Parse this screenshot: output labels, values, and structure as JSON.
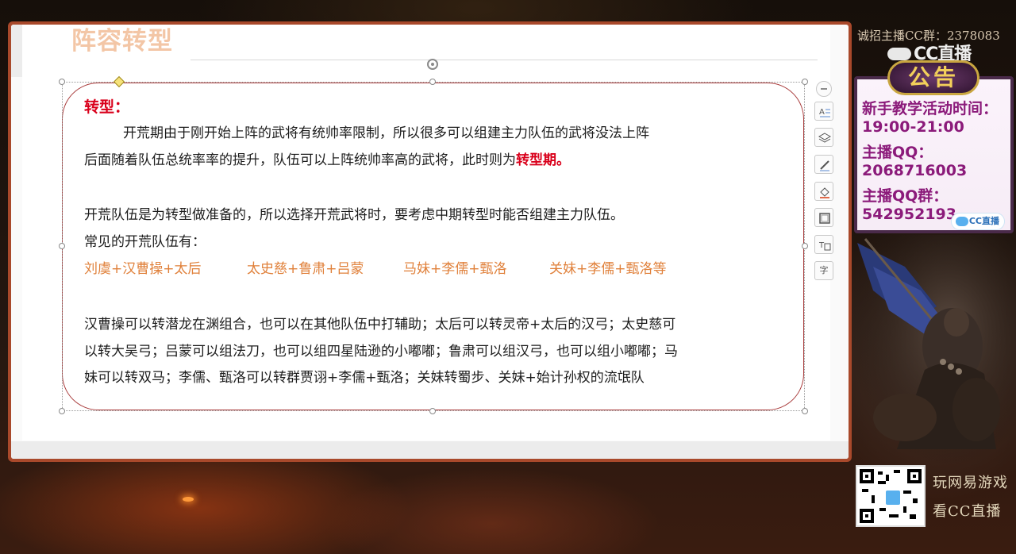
{
  "slide": {
    "title": "阵容转型",
    "heading": "转型：",
    "paragraph1_line1": "开荒期由于刚开始上阵的武将有统帅率限制，所以很多可以组建主力队伍的武将没法上阵",
    "paragraph1_line2_prefix": "后面随着队伍总统率率的提升，队伍可以上阵统帅率高的武将，此时则为",
    "paragraph1_line2_highlight": "转型期。",
    "paragraph2": "开荒队伍是为转型做准备的，所以选择开荒武将时，要考虑中期转型时能否组建主力队伍。",
    "paragraph3": "常见的开荒队伍有：",
    "teams": [
      "刘虞+汉曹操+太后",
      "太史慈+鲁肃+吕蒙",
      "马妹+李儒+甄洛",
      "关妹+李儒+甄洛等"
    ],
    "paragraph4": [
      "汉曹操可以转潜龙在渊组合，也可以在其他队伍中打辅助；太后可以转灵帝+太后的汉弓；太史慈可",
      "以转大吴弓；吕蒙可以组法刀，也可以组四星陆逊的小嘟嘟；鲁肃可以组汉弓，也可以组小嘟嘟；马",
      "妹可以转双马；李儒、甄洛可以转群贾诩+李儒+甄洛；关妹转蜀步、关妹+始计孙权的流氓队"
    ]
  },
  "side_toolbar": {
    "icons": [
      "collapse-icon",
      "text-format-icon",
      "layers-icon",
      "pen-icon",
      "fill-icon",
      "border-icon",
      "text-box-icon",
      "character-icon"
    ],
    "char_label": "字"
  },
  "stream_panel": {
    "recruit_banner": "诚招主播CC群：2378083",
    "cc_logo": "CC直播",
    "notice_title": "公告",
    "notice_lines": [
      "新手教学活动时间：",
      "19:00-21:00",
      "主播QQ：",
      "2068716003",
      "主播QQ群：",
      "542952193"
    ],
    "cc_mini_logo": "CC直播",
    "promo_line1": "玩网易游戏",
    "promo_line2": "看CC直播"
  },
  "colors": {
    "accent_red": "#d9001b",
    "team_orange": "#e0803a",
    "title_peach": "#f3c6a6",
    "frame": "#a9492b",
    "notice_purple": "#8b1a7a"
  }
}
